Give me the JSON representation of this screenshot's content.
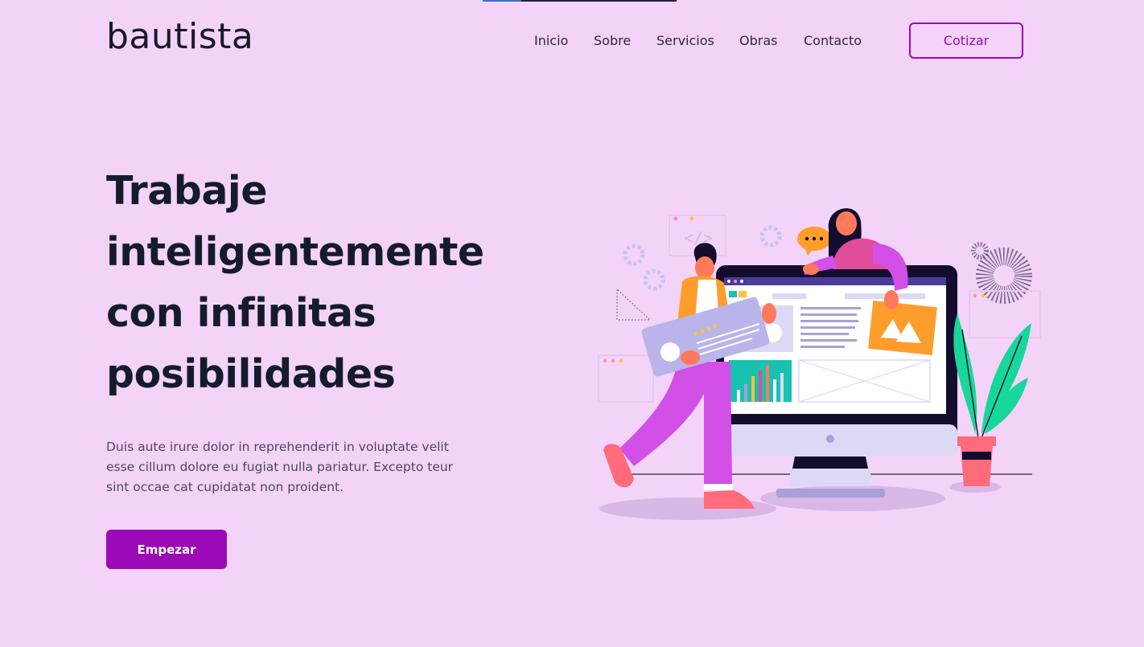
{
  "brand": {
    "name": "bautista"
  },
  "nav": {
    "items": [
      {
        "label": "Inicio"
      },
      {
        "label": "Sobre"
      },
      {
        "label": "Servicios"
      },
      {
        "label": "Obras"
      },
      {
        "label": "Contacto"
      }
    ],
    "cta_label": "Cotizar"
  },
  "hero": {
    "title_lines": [
      "Trabaje",
      "inteligentemente",
      "con infinitas",
      "posibilidades"
    ],
    "text_lines": [
      "Duis aute irure dolor in reprehenderit in voluptate velit",
      "esse cillum dolore eu fugiat nulla pariatur. Excepto teur",
      "sint occae cat cupidatat non proident."
    ],
    "button_label": "Empezar"
  },
  "colors": {
    "background": "#f4d3f8",
    "accent": "#9b0ab6",
    "text_dark": "#141b2d",
    "text_body": "#4b4a5c"
  },
  "illustration": {
    "icon": "web-design-illustration"
  }
}
